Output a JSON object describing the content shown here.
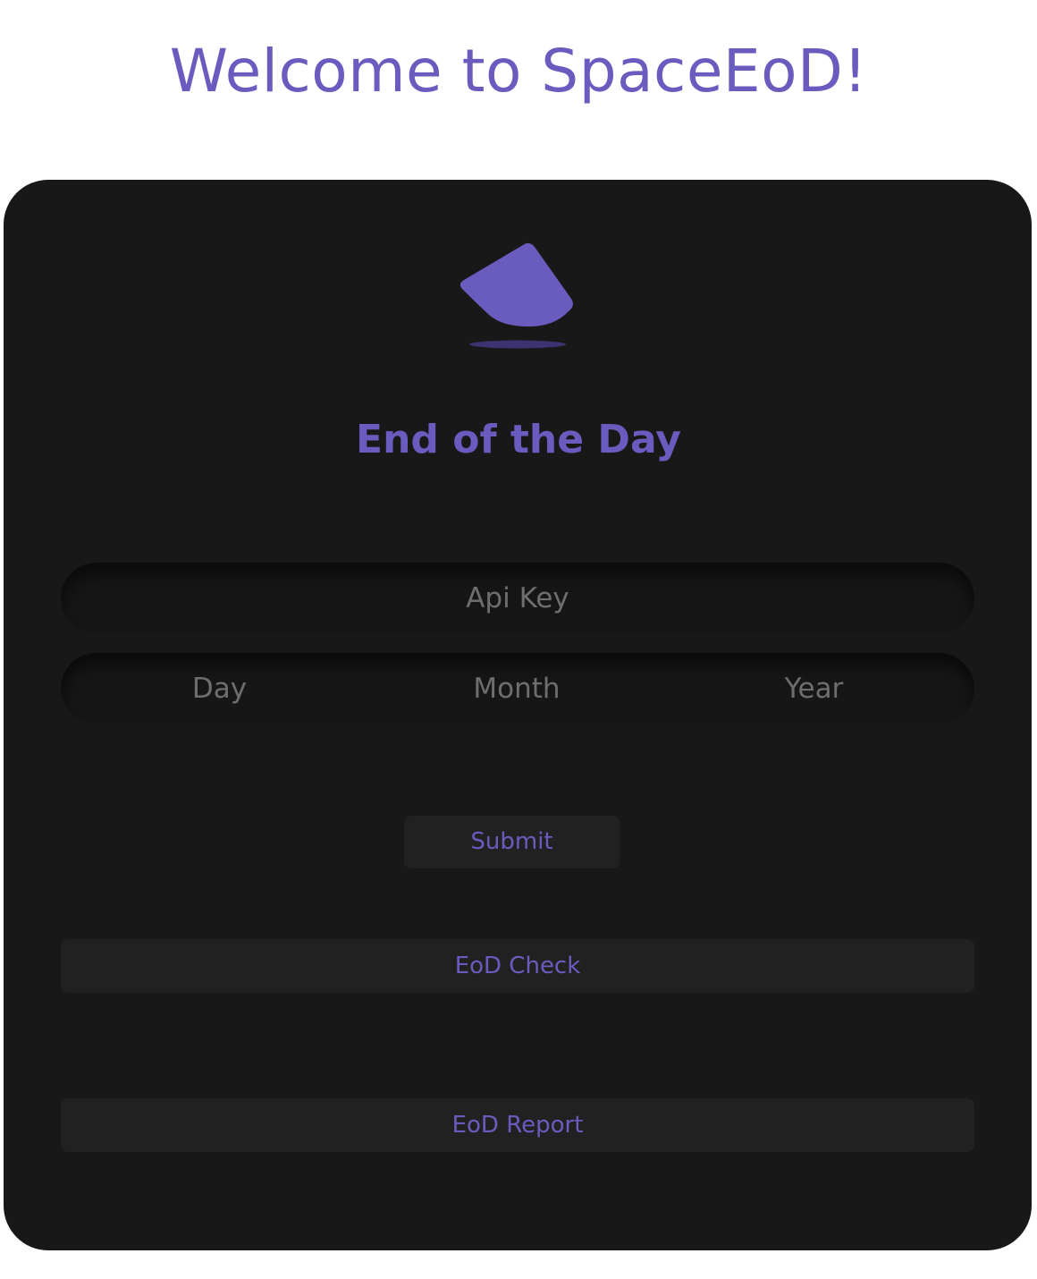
{
  "header": {
    "title": "Welcome to SpaceEoD!"
  },
  "card": {
    "title": "End of the Day"
  },
  "logo": {
    "icon": "box-logo-icon",
    "color": "#6a5cbf"
  },
  "form": {
    "api_key_placeholder": "Api Key",
    "day_placeholder": "Day",
    "month_placeholder": "Month",
    "year_placeholder": "Year",
    "submit_label": "Submit"
  },
  "actions": {
    "eod_check_label": "EoD Check",
    "eod_report_label": "EoD Report"
  },
  "colors": {
    "accent": "#6a5cbf",
    "card_background": "#181818",
    "button_background": "#212121",
    "page_background": "#ffffff"
  }
}
